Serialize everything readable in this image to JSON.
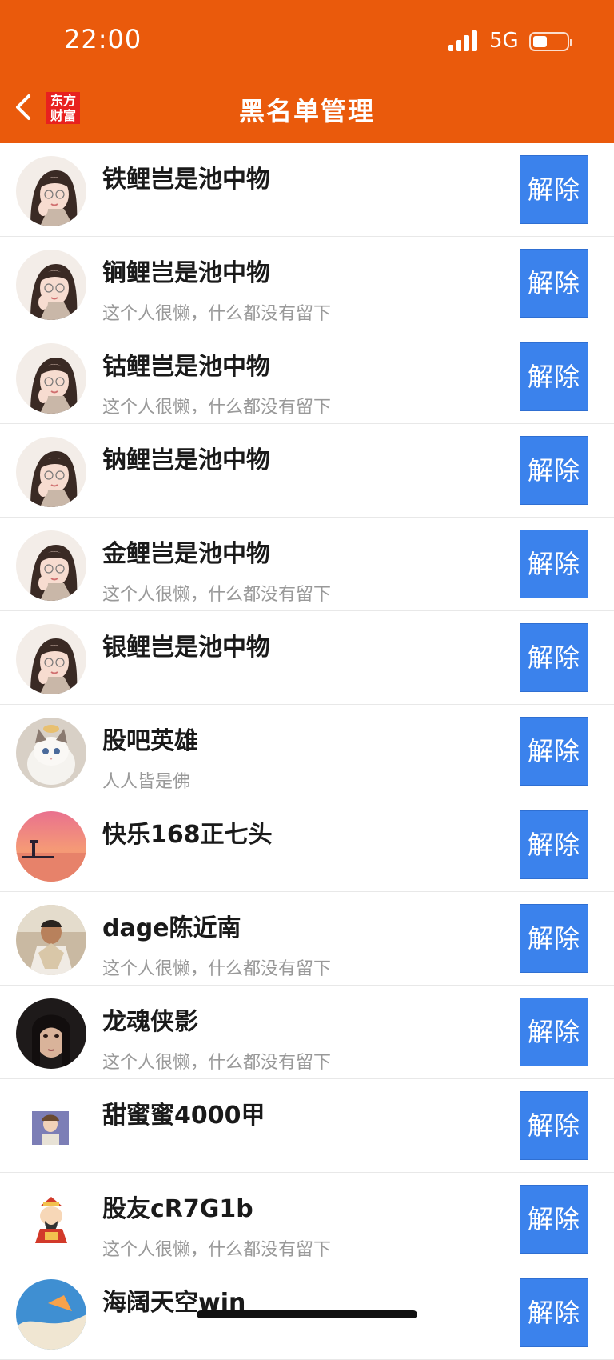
{
  "status_bar": {
    "time": "22:00",
    "network": "5G"
  },
  "header": {
    "logo": "东方\n财富",
    "logo_line1": "东方",
    "logo_line2": "财富",
    "title": "黑名单管理"
  },
  "button_label": "解除",
  "rows": [
    {
      "name": "铁鲤岂是池中物",
      "signature": "",
      "avatar": "girl"
    },
    {
      "name": "锏鲤岂是池中物",
      "signature": "这个人很懒，什么都没有留下",
      "avatar": "girl"
    },
    {
      "name": "钴鲤岂是池中物",
      "signature": "这个人很懒，什么都没有留下",
      "avatar": "girl"
    },
    {
      "name": "钠鲤岂是池中物",
      "signature": "",
      "avatar": "girl"
    },
    {
      "name": "金鲤岂是池中物",
      "signature": "这个人很懒，什么都没有留下",
      "avatar": "girl"
    },
    {
      "name": "银鲤岂是池中物",
      "signature": "",
      "avatar": "girl"
    },
    {
      "name": "股吧英雄",
      "signature": "人人皆是佛",
      "avatar": "cat"
    },
    {
      "name": "快乐168正七头",
      "signature": "",
      "avatar": "sunset"
    },
    {
      "name": "dage陈近南",
      "signature": "这个人很懒，什么都没有留下",
      "avatar": "man"
    },
    {
      "name": "龙魂侠影",
      "signature": "这个人很懒，什么都没有留下",
      "avatar": "woman"
    },
    {
      "name": "甜蜜蜜4000甲",
      "signature": "",
      "avatar": "photo"
    },
    {
      "name": "股友cR7G1b",
      "signature": "这个人很懒，什么都没有留下",
      "avatar": "god"
    },
    {
      "name": "海阔天空win",
      "signature": "",
      "avatar": "sky"
    }
  ]
}
